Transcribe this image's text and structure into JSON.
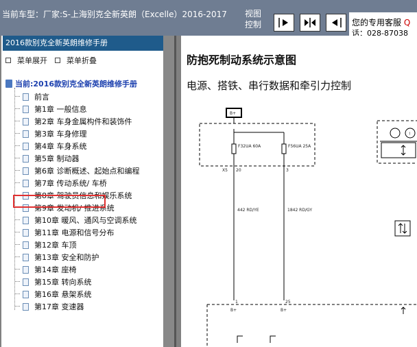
{
  "topbar": {
    "car_info": "当前车型：厂家:S-上海别克全新英朗（Excelle）2016-2017",
    "view_label_line1": "视图",
    "view_label_line2": "控制",
    "support_line1_prefix": "您的专用客服 ",
    "support_line1_suffix": "Q",
    "support_line2": "话：028-87038"
  },
  "left_panel": {
    "title": "2016款别克全新英朗维修手册",
    "expand_label": "菜单展开",
    "collapse_label": "菜单折叠",
    "root_label": "当前:2016款别克全新英朗维修手册",
    "items": [
      "前言",
      "第1章 一般信息",
      "第2章 车身金属构件和装饰件",
      "第3章 车身修理",
      "第4章 车身系统",
      "第5章 制动器",
      "第6章 诊断概述、起始点和编程",
      "第7章 传动系统/ 车桥",
      "第8章 驾驶员信息和娱乐系统",
      "第9章 发动机/ 推进系统",
      "第10章 暖风、通风与空调系统",
      "第11章 电源和信号分布",
      "第12章 车顶",
      "第13章 安全和防护",
      "第14章 座椅",
      "第15章 转向系统",
      "第16章 悬架系统",
      "第17章 变速器"
    ],
    "selected_item": "第5章 制动器"
  },
  "document": {
    "title": "防抱死制动系统示意图",
    "subtitle": "电源、搭铁、串行数据和牵引力控制"
  },
  "diagram": {
    "terminal": "B+",
    "connector_left": "X5",
    "pin_left_top": "20",
    "pin_right_top": "3",
    "fuse_left": "F32UA 60A",
    "fuse_right": "F56UA 25A",
    "wire_left": "442 RD/YE",
    "wire_right": "1842 RD/GY",
    "pin_left_bottom": "1",
    "pin_right_bottom": "25",
    "label_bplus": "B+"
  }
}
